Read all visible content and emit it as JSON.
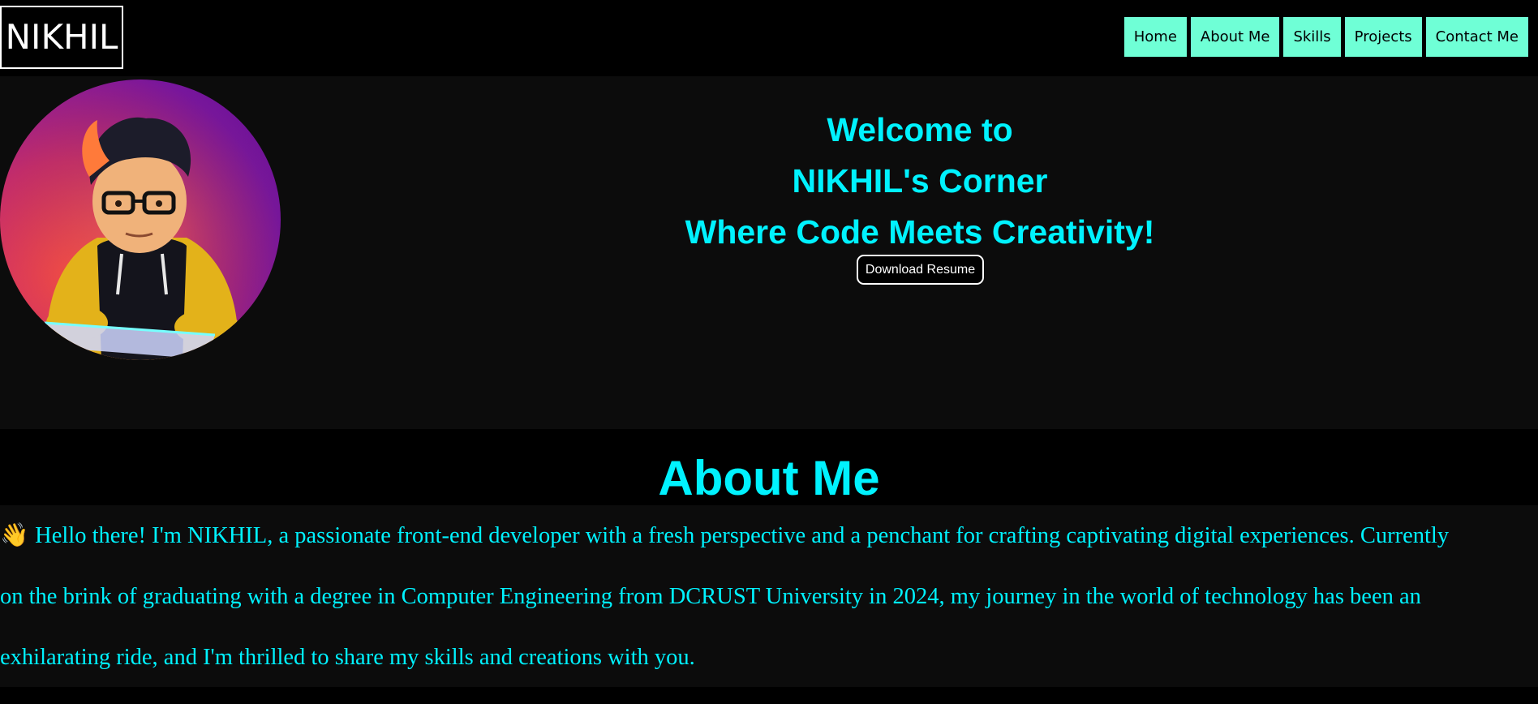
{
  "header": {
    "logo": "NIKHIL",
    "nav": [
      "Home",
      "About Me",
      "Skills",
      "Projects",
      "Contact Me"
    ]
  },
  "hero": {
    "line1": "Welcome to",
    "line2": "NIKHIL's Corner",
    "line3": "Where Code Meets Creativity!",
    "resume_button": "Download Resume"
  },
  "about": {
    "title": "About Me",
    "wave_emoji": "👋",
    "lines": [
      "Hello there! I'm NIKHIL, a passionate front-end developer with a fresh perspective and a penchant for crafting captivating digital experiences. Currently",
      "on the brink of graduating with a degree in Computer Engineering from DCRUST University in 2024, my journey in the world of technology has been an",
      "exhilarating ride, and I'm thrilled to share my skills and creations with you."
    ]
  },
  "colors": {
    "accent": "#00f2ff",
    "nav_bg": "#6fffd6",
    "page_bg": "#000000",
    "section_bg": "#0c0c0c"
  }
}
